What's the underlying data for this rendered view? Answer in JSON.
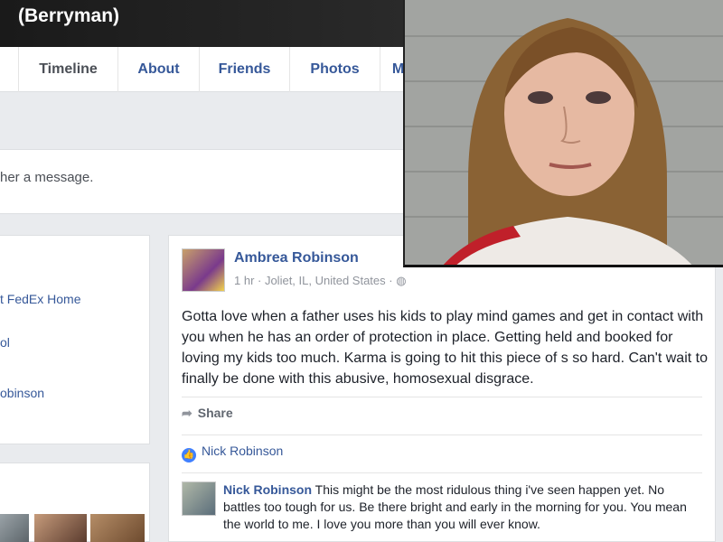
{
  "profile": {
    "cover_name": "(Berryman)"
  },
  "tabs": [
    {
      "label": "Timeline"
    },
    {
      "label": "About"
    },
    {
      "label": "Friends"
    },
    {
      "label": "Photos"
    },
    {
      "label": "M"
    }
  ],
  "message_prompt": "her a message.",
  "intro": {
    "lines": [
      "t FedEx Home",
      "ol",
      "obinson"
    ]
  },
  "post": {
    "author": "Ambrea Robinson",
    "meta": "1 hr · Joliet, IL, United States · ◍",
    "text": "Gotta love when a father uses his kids to play mind games and get in contact with you when he has an order of protection in place. Getting held and booked for loving my kids too much. Karma is going to hit this piece of s      so hard. Can't wait to finally be done with this abusive, homosexual disgrace.",
    "share_label": "Share",
    "likes": "Nick Robinson",
    "comment": {
      "author": "Nick Robinson",
      "text": "This might be the most ridulous thing i've seen happen yet. No battles too tough for us. Be there bright and early in the morning for you. You mean the world to me. I love you more than you will ever know."
    }
  },
  "colors": {
    "link": "#365899",
    "background": "#e9ebee",
    "like_blue": "#4080ff"
  },
  "icons": {
    "share": "share-arrow-icon",
    "like": "thumbs-up-icon",
    "privacy": "globe-icon"
  }
}
